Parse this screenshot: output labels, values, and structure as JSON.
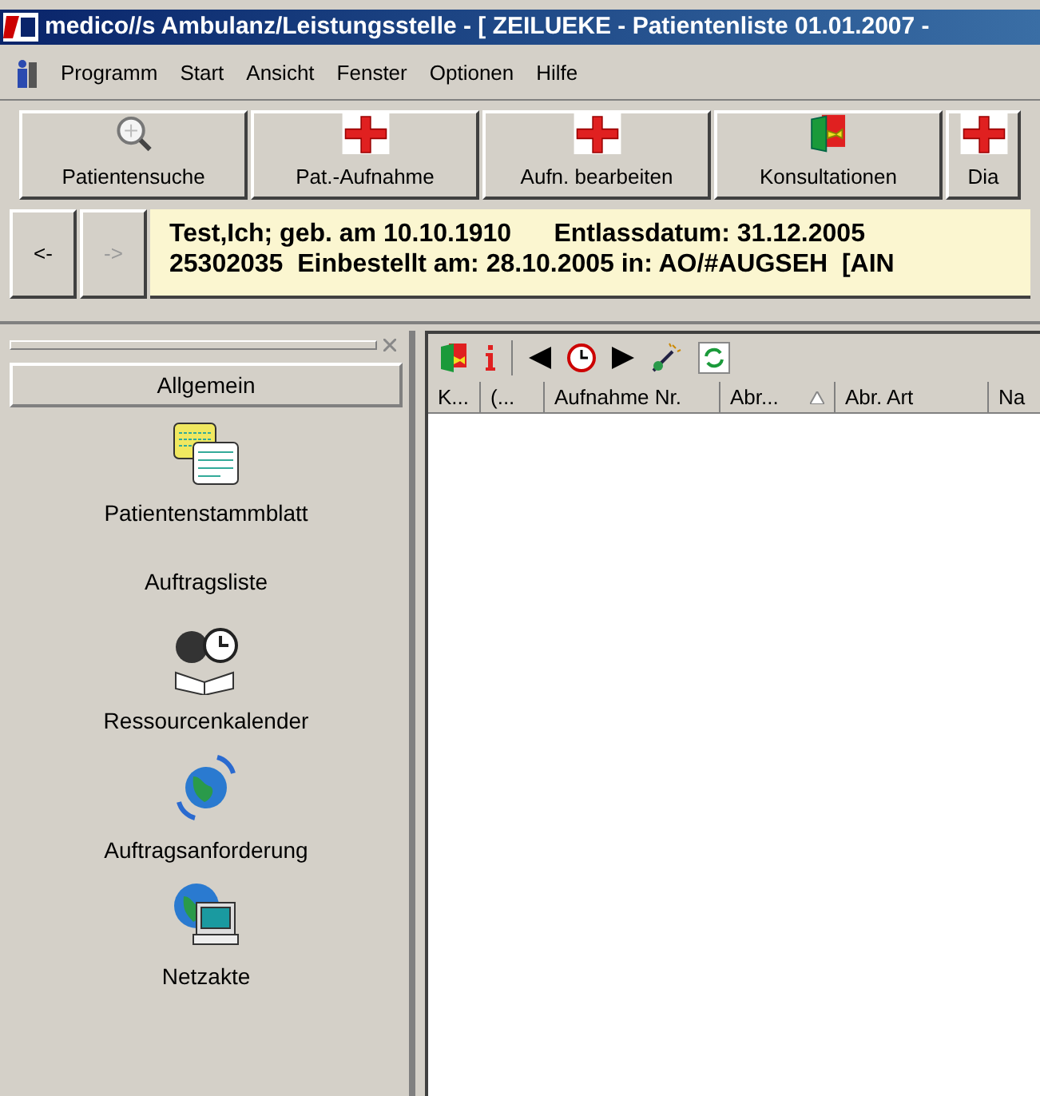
{
  "window": {
    "title": "medico//s Ambulanz/Leistungsstelle  - [ ZEILUEKE - Patientenliste  01.01.2007 -"
  },
  "menu": [
    "Programm",
    "Start",
    "Ansicht",
    "Fenster",
    "Optionen",
    "Hilfe"
  ],
  "toolbar": [
    {
      "label": "Patientensuche",
      "kind": "search"
    },
    {
      "label": "Pat.-Aufnahme",
      "kind": "cross"
    },
    {
      "label": "Aufn. bearbeiten",
      "kind": "cross"
    },
    {
      "label": "Konsultationen",
      "kind": "door"
    },
    {
      "label": "Dia",
      "kind": "cross"
    }
  ],
  "patient_bar": {
    "back": {
      "label": "<-",
      "disabled": false
    },
    "forward": {
      "label": "->",
      "disabled": true
    },
    "lines": [
      "Test,Ich; geb. am 10.10.1910      Entlassdatum: 31.12.2005",
      "25302035  Einbestellt am: 28.10.2005 in: AO/#AUGSEH  [AIN"
    ]
  },
  "sidebar": {
    "group": "Allgemein",
    "items": [
      {
        "label": "Patientenstammblatt",
        "kind": "sheet"
      },
      {
        "label": "Auftragsliste",
        "kind": "none"
      },
      {
        "label": "Ressourcenkalender",
        "kind": "calendar"
      },
      {
        "label": "Auftragsanforderung",
        "kind": "globe"
      },
      {
        "label": "Netzakte",
        "kind": "network"
      }
    ]
  },
  "list": {
    "columns": [
      {
        "label": "K...",
        "sorted": false
      },
      {
        "label": "(...",
        "sorted": false
      },
      {
        "label": "Aufnahme Nr.",
        "sorted": false
      },
      {
        "label": "Abr...",
        "sorted": true
      },
      {
        "label": "Abr. Art",
        "sorted": false
      },
      {
        "label": "Na",
        "sorted": false
      }
    ]
  }
}
